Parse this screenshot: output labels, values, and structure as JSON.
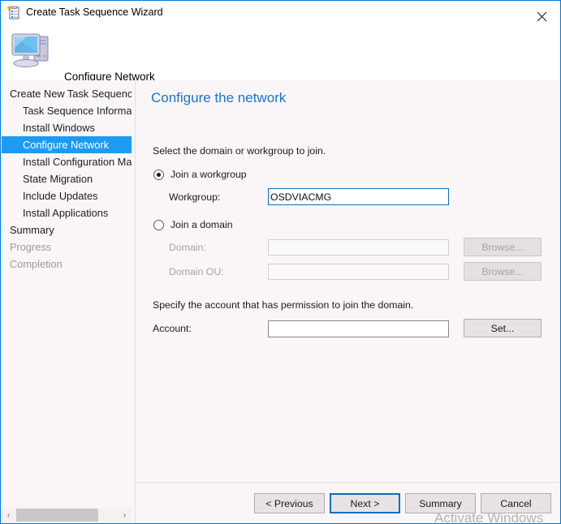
{
  "window": {
    "title": "Create Task Sequence Wizard",
    "title_icon": "task-sequence-clipboard-icon",
    "close_label": "✕",
    "accent_color": "#0078d7",
    "background": "#faf6f8"
  },
  "header": {
    "title": "Configure Network",
    "icon": "computer-icon"
  },
  "sidebar": {
    "items": [
      {
        "label": "Create New Task Sequence",
        "level": 0,
        "state": "normal"
      },
      {
        "label": "Task Sequence Information",
        "level": 1,
        "state": "normal"
      },
      {
        "label": "Install Windows",
        "level": 1,
        "state": "normal"
      },
      {
        "label": "Configure Network",
        "level": 1,
        "state": "selected"
      },
      {
        "label": "Install Configuration Manager",
        "level": 1,
        "state": "normal"
      },
      {
        "label": "State Migration",
        "level": 1,
        "state": "normal"
      },
      {
        "label": "Include Updates",
        "level": 1,
        "state": "normal"
      },
      {
        "label": "Install Applications",
        "level": 1,
        "state": "normal"
      },
      {
        "label": "Summary",
        "level": 0,
        "state": "normal"
      },
      {
        "label": "Progress",
        "level": 0,
        "state": "disabled"
      },
      {
        "label": "Completion",
        "level": 0,
        "state": "disabled"
      }
    ],
    "selected_color": "#1d9bf0",
    "scrollbar": {
      "left_arrow": "‹",
      "right_arrow": "›"
    }
  },
  "content": {
    "heading": "Configure the network",
    "heading_color": "#1973d2",
    "instruction_select": "Select the domain or workgroup to join.",
    "instruction_account": "Specify the account that has permission to join the domain.",
    "radio_workgroup": {
      "label": "Join a workgroup",
      "checked": true
    },
    "radio_domain": {
      "label": "Join a domain",
      "checked": false
    },
    "field_workgroup": {
      "label": "Workgroup:",
      "value": "OSDVIACMG",
      "focused": true
    },
    "field_domain": {
      "label": "Domain:",
      "value": "",
      "disabled": true
    },
    "field_domain_ou": {
      "label": "Domain OU:",
      "value": "",
      "disabled": true
    },
    "field_account": {
      "label": "Account:",
      "value": "",
      "disabled": false
    },
    "browse_domain_label": "Browse...",
    "browse_ou_label": "Browse...",
    "set_label": "Set..."
  },
  "footer": {
    "previous_label": "< Previous",
    "next_label": "Next >",
    "summary_label": "Summary",
    "cancel_label": "Cancel"
  },
  "watermark": {
    "text": "Activate Windows"
  }
}
